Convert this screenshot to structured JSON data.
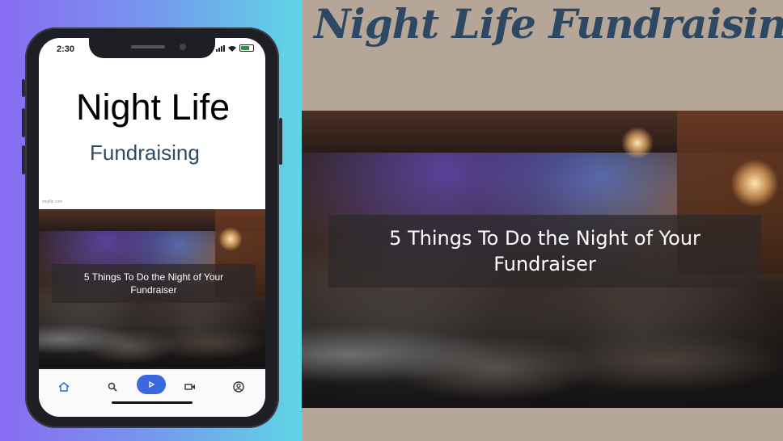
{
  "phone": {
    "status_time": "2:30",
    "title": "Night Life",
    "subtitle": "Fundraising",
    "credit": "imgflip.com",
    "caption": "5 Things To Do the Night of Your Fundraiser",
    "nav": {
      "items": [
        "home-icon",
        "search-icon",
        "play-icon",
        "video-icon",
        "account-icon"
      ],
      "active_color": "#3b67df"
    }
  },
  "main": {
    "title": "Night Life Fundraising",
    "caption": "5 Things To Do the Night of Your Fundraiser"
  },
  "colors": {
    "background": "#b6a697",
    "title": "#2c4863",
    "gradient_left": "#8a6bf2",
    "gradient_right": "#5fd5e6"
  }
}
